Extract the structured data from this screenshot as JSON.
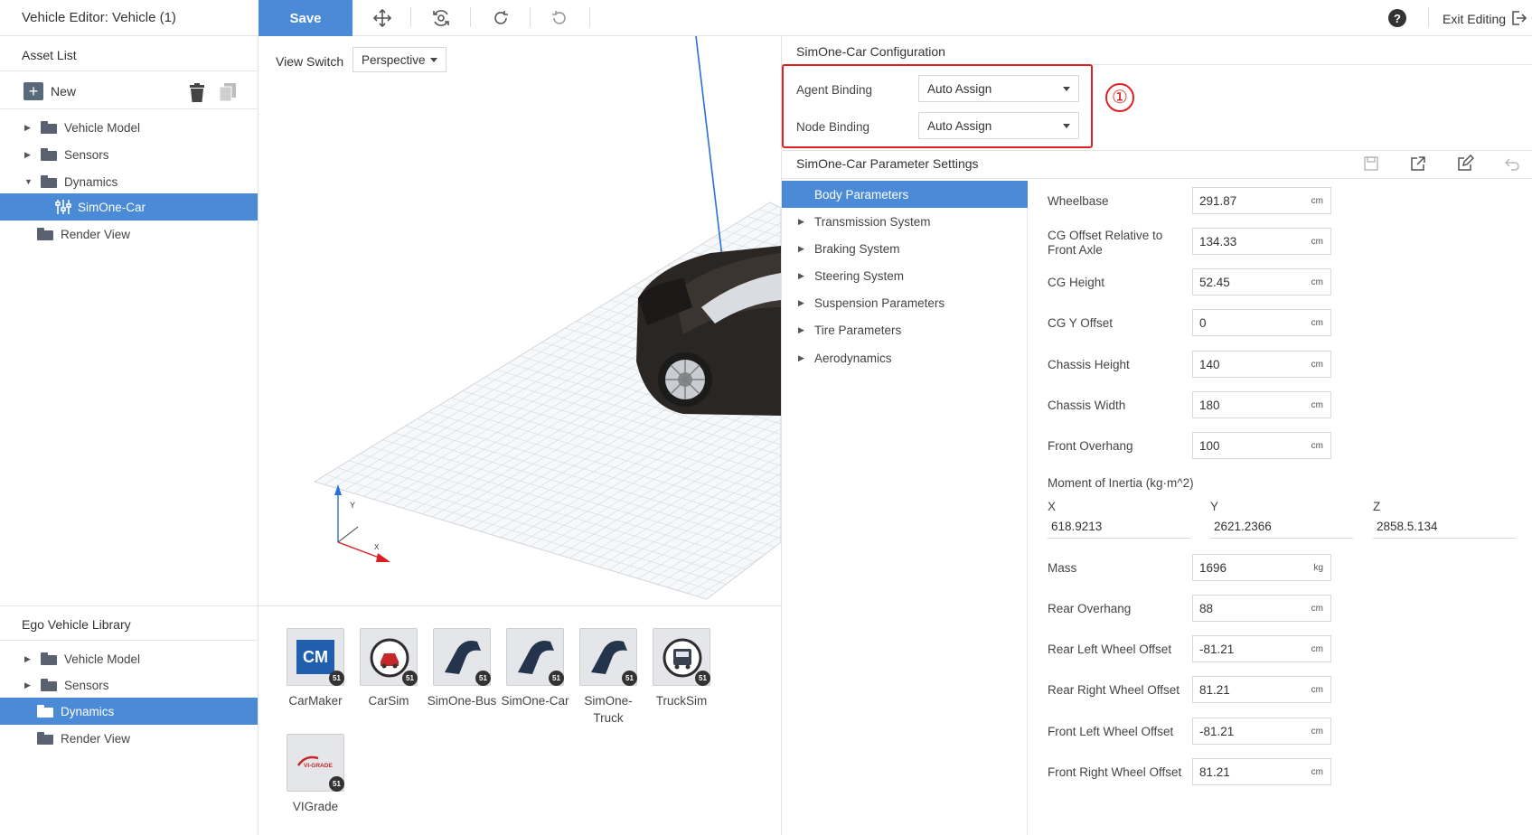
{
  "window": {
    "title": "Vehicle Editor: Vehicle (1)"
  },
  "toolbar": {
    "save_label": "Save",
    "tools": [
      "move-icon",
      "rotate-view-icon",
      "redo-icon",
      "undo-icon"
    ],
    "exit_label": "Exit Editing"
  },
  "asset_list": {
    "title": "Asset List",
    "new_label": "New",
    "items": [
      {
        "label": "Vehicle Model",
        "expanded": false
      },
      {
        "label": "Sensors",
        "expanded": false
      },
      {
        "label": "Dynamics",
        "expanded": true
      },
      {
        "label": "SimOne-Car",
        "selected": true
      },
      {
        "label": "Render View"
      }
    ]
  },
  "ego_library": {
    "title": "Ego Vehicle Library",
    "items": [
      {
        "label": "Vehicle Model"
      },
      {
        "label": "Sensors"
      },
      {
        "label": "Dynamics",
        "selected": true
      },
      {
        "label": "Render View"
      }
    ]
  },
  "viewport": {
    "view_switch_label": "View Switch",
    "view_mode": "Perspective",
    "axis_labels": {
      "y": "Y",
      "x": "X"
    }
  },
  "vehicle_library": {
    "badge": "51",
    "items": [
      {
        "label": "CarMaker",
        "tile_text": "CM",
        "icon": "carmaker-icon"
      },
      {
        "label": "CarSim",
        "icon": "carsim-icon"
      },
      {
        "label": "SimOne-Bus",
        "icon": "simone-bus-icon"
      },
      {
        "label": "SimOne-Car",
        "icon": "simone-car-icon"
      },
      {
        "label": "SimOne-Truck",
        "icon": "simone-truck-icon"
      },
      {
        "label": "TruckSim",
        "icon": "trucksim-icon"
      },
      {
        "label": "VIGrade",
        "tile_text": "VI-GRADE",
        "icon": "vigrade-icon"
      }
    ]
  },
  "config": {
    "title": "SimOne-Car Configuration",
    "agent_binding_label": "Agent Binding",
    "agent_binding_value": "Auto Assign",
    "node_binding_label": "Node Binding",
    "node_binding_value": "Auto Assign",
    "annotation": "①",
    "annotation_color": "#e02020"
  },
  "params": {
    "title": "SimOne-Car Parameter Settings",
    "categories": [
      {
        "label": "Body Parameters",
        "selected": true
      },
      {
        "label": "Transmission System"
      },
      {
        "label": "Braking System"
      },
      {
        "label": "Steering System"
      },
      {
        "label": "Suspension Parameters"
      },
      {
        "label": "Tire Parameters"
      },
      {
        "label": "Aerodynamics"
      }
    ],
    "fields_top": [
      {
        "label": "Wheelbase",
        "value": "291.87",
        "unit": "cm"
      },
      {
        "label": "CG Offset Relative to Front Axle",
        "value": "134.33",
        "unit": "cm"
      },
      {
        "label": "CG Height",
        "value": "52.45",
        "unit": "cm"
      },
      {
        "label": "CG Y Offset",
        "value": "0",
        "unit": "cm"
      },
      {
        "label": "Chassis Height",
        "value": "140",
        "unit": "cm"
      },
      {
        "label": "Chassis Width",
        "value": "180",
        "unit": "cm"
      },
      {
        "label": "Front Overhang",
        "value": "100",
        "unit": "cm"
      }
    ],
    "inertia": {
      "label": "Moment of Inertia (kg·m^2)",
      "axes": [
        "X",
        "Y",
        "Z"
      ],
      "values": [
        "618.9213",
        "2621.2366",
        "2858.5.134"
      ]
    },
    "fields_bottom": [
      {
        "label": "Mass",
        "value": "1696",
        "unit": "kg"
      },
      {
        "label": "Rear Overhang",
        "value": "88",
        "unit": "cm"
      },
      {
        "label": "Rear Left Wheel Offset",
        "value": "-81.21",
        "unit": "cm"
      },
      {
        "label": "Rear Right Wheel Offset",
        "value": "81.21",
        "unit": "cm"
      },
      {
        "label": "Front Left Wheel Offset",
        "value": "-81.21",
        "unit": "cm"
      },
      {
        "label": "Front Right Wheel Offset",
        "value": "81.21",
        "unit": "cm"
      }
    ]
  },
  "colors": {
    "accent": "#4a8ad6",
    "highlight": "#e02020"
  }
}
